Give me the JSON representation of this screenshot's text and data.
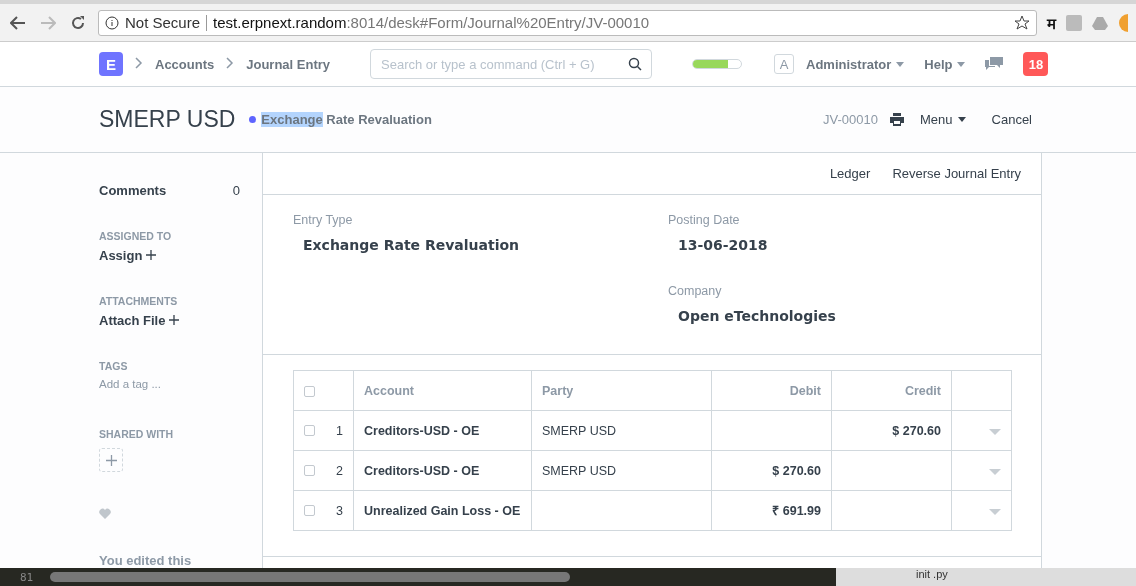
{
  "browser": {
    "security": "Not Secure",
    "url_host": "test.erpnext.random",
    "url_rest": ":8014/desk#Form/Journal%20Entry/JV-00010",
    "ext_label": "म"
  },
  "navbar": {
    "logo": "E",
    "breadcrumbs": [
      "Accounts",
      "Journal Entry"
    ],
    "search": {
      "placeholder": "Search or type a command (Ctrl + G)"
    },
    "progress": {
      "level": 0.72
    },
    "avatar": "A",
    "user": "Administrator",
    "help": "Help",
    "notifications": "18"
  },
  "header": {
    "title": "SMERP USD",
    "status": "Exchange Rate Revaluation",
    "status_dot": {
      "color": "#5e64ff"
    },
    "doc_id": "JV-00010",
    "menu": "Menu",
    "cancel": "Cancel"
  },
  "sidebar": {
    "comments_label": "Comments",
    "comments_count": "0",
    "sections": [
      {
        "heading": "ASSIGNED TO",
        "action": "Assign"
      },
      {
        "heading": "ATTACHMENTS",
        "action": "Attach File"
      }
    ],
    "tags_heading": "TAGS",
    "tags_placeholder": "Add a tag ...",
    "shared_heading": "SHARED WITH",
    "activity": "You edited this"
  },
  "toolbar": [
    "Ledger",
    "Reverse Journal Entry"
  ],
  "fields": [
    {
      "label": "Entry Type",
      "value": "Exchange Rate Revaluation"
    },
    {
      "label": "Posting Date",
      "value": "13-06-2018"
    },
    {
      "label": "Company",
      "value": "Open eTechnologies"
    }
  ],
  "table": {
    "select_all_checked": false,
    "columns": [
      "Account",
      "Party",
      "Debit",
      "Credit"
    ],
    "rows": [
      {
        "checked": false,
        "index": "1",
        "account": "Creditors-USD - OE",
        "party": "SMERP USD",
        "debit": "",
        "credit": "$ 270.60"
      },
      {
        "checked": false,
        "index": "2",
        "account": "Creditors-USD - OE",
        "party": "SMERP USD",
        "debit": "$ 270.60",
        "credit": ""
      },
      {
        "checked": false,
        "index": "3",
        "account": "Unrealized Gain Loss - OE",
        "party": "",
        "debit": "₹ 691.99",
        "credit": ""
      }
    ]
  },
  "editor": {
    "line_number": "81",
    "file": "init .py"
  }
}
